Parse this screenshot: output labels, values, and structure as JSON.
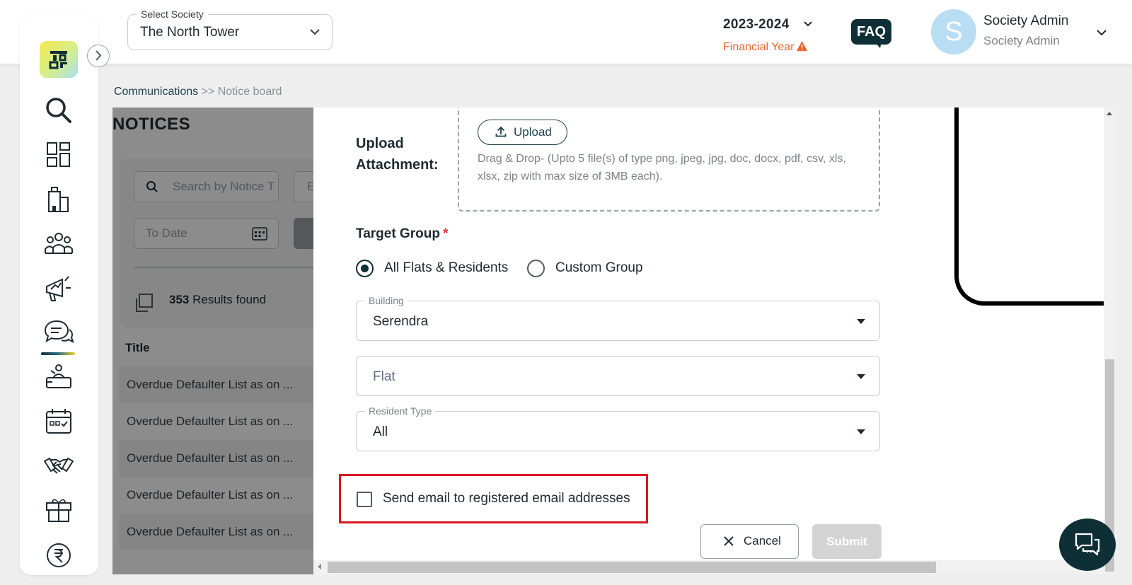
{
  "header": {
    "society_select_label": "Select Society",
    "society_value": "The North Tower",
    "financial_year_value": "2023-2024",
    "financial_year_label": "Financial Year",
    "faq_label": "FAQ",
    "user_initial": "S",
    "user_name": "Society Admin",
    "user_role": "Society Admin"
  },
  "sidebar": {
    "items": [
      {
        "icon": "search-icon"
      },
      {
        "icon": "dashboard-icon"
      },
      {
        "icon": "building-icon"
      },
      {
        "icon": "members-icon"
      },
      {
        "icon": "megaphone-icon"
      },
      {
        "icon": "chat-bubbles-icon",
        "active": true
      },
      {
        "icon": "helpdesk-icon"
      },
      {
        "icon": "calendar-icon"
      },
      {
        "icon": "handshake-icon"
      },
      {
        "icon": "box-icon"
      },
      {
        "icon": "rupee-icon"
      }
    ]
  },
  "breadcrumb": {
    "link": "Communications",
    "separator": " >> ",
    "current": "Notice board"
  },
  "background_page": {
    "title": "NOTICES",
    "search_placeholder": "Search by Notice T",
    "partial_filter": "E",
    "to_date_placeholder": "To Date",
    "results_count": "353",
    "results_label": " Results found",
    "table_title_header": "Title",
    "rows": [
      "Overdue Defaulter List as on ...",
      "Overdue Defaulter List as on ...",
      "Overdue Defaulter List as on ...",
      "Overdue Defaulter List as on ...",
      "Overdue Defaulter List as on ..."
    ]
  },
  "form": {
    "upload_label_line1": "Upload",
    "upload_label_line2": "Attachment:",
    "upload_button": "Upload",
    "drop_text": "Drag & Drop- (Upto 5 file(s) of type png, jpeg, jpg, doc, docx, pdf, csv, xls, xlsx, zip with max size of 3MB each).",
    "target_group_label": "Target Group",
    "required_mark": "*",
    "radio_all": "All Flats & Residents",
    "radio_custom": "Custom Group",
    "radio_selected": "All Flats & Residents",
    "building_label": "Building",
    "building_value": "Serendra",
    "flat_placeholder": "Flat",
    "resident_type_label": "Resident Type",
    "resident_type_value": "All",
    "send_email_label": "Send email to registered email addresses",
    "send_email_checked": false,
    "cancel_label": "Cancel",
    "submit_label": "Submit"
  },
  "colors": {
    "brand_dark": "#0e2f35",
    "accent_orange": "#e8632b",
    "highlight_red": "#d7191f",
    "required_red": "#e53935"
  }
}
